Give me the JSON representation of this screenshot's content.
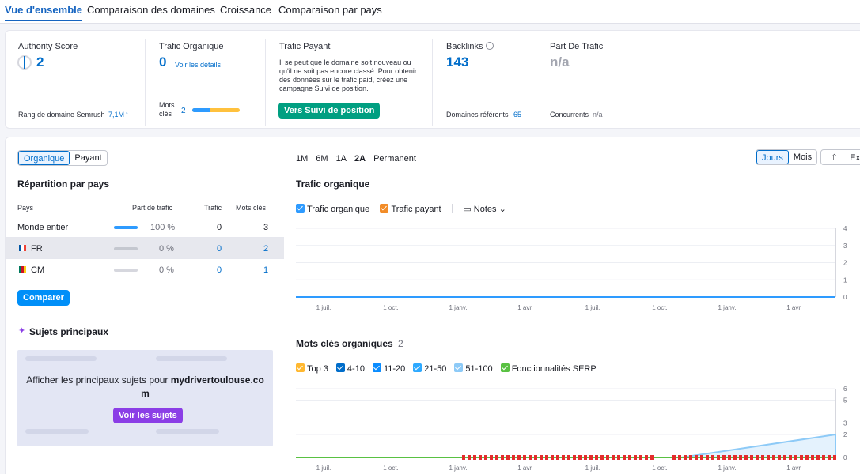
{
  "tabs": [
    "Vue d'ensemble",
    "Comparaison des domaines",
    "Croissance",
    "Comparaison par pays"
  ],
  "summary": {
    "authority": {
      "label": "Authority Score",
      "value": "2",
      "sub_label": "Rang de domaine Semrush",
      "sub_value": "7,1M",
      "sub_arrow": "↑"
    },
    "organic": {
      "label": "Trafic Organique",
      "value": "0",
      "details_link": "Voir les détails",
      "keywords_label": "Mots clés",
      "keywords_value": "2"
    },
    "paid": {
      "label": "Trafic Payant",
      "message": "Il se peut que le domaine soit nouveau ou qu'il ne soit pas encore classé. Pour obtenir des données sur le trafic paid, créez une campagne Suivi de position.",
      "button": "Vers Suivi de position"
    },
    "backlinks": {
      "label": "Backlinks",
      "value": "143",
      "ref_label": "Domaines référents",
      "ref_value": "65"
    },
    "share": {
      "label": "Part De Trafic",
      "value": "n/a",
      "comp_label": "Concurrents",
      "comp_value": "n/a"
    }
  },
  "left": {
    "toggle": [
      "Organique",
      "Payant"
    ],
    "country_title": "Répartition par pays",
    "headers": [
      "Pays",
      "Part de trafic",
      "Trafic",
      "Mots clés"
    ],
    "rows": [
      {
        "country": "Monde entier",
        "share": "100 %",
        "traffic": "0",
        "keywords": "3"
      },
      {
        "country": "FR",
        "share": "0 %",
        "traffic": "0",
        "keywords": "2"
      },
      {
        "country": "CM",
        "share": "0 %",
        "traffic": "0",
        "keywords": "1"
      }
    ],
    "compare_button": "Comparer",
    "topics_title": "Sujets principaux",
    "topics_text": "Afficher les principaux sujets pour",
    "topics_domain": "mydrivertoulouse.com",
    "topics_button": "Voir les sujets"
  },
  "right": {
    "periods": [
      "1M",
      "6M",
      "1A",
      "2A",
      "Permanent"
    ],
    "active_period": "2A",
    "view_toggle": [
      "Jours",
      "Mois"
    ],
    "export_label": "Expor",
    "traffic_title": "Trafic organique",
    "traffic_legend": [
      "Trafic organique",
      "Trafic payant"
    ],
    "notes_label": "Notes",
    "keywords_title": "Mots clés organiques",
    "keywords_count": "2",
    "keywords_legend": [
      "Top 3",
      "4-10",
      "11-20",
      "21-50",
      "51-100",
      "Fonctionnalités SERP"
    ]
  },
  "chart_data": [
    {
      "type": "line",
      "title": "Trafic organique",
      "x_ticks": [
        "1 juil.",
        "1 oct.",
        "1 janv.",
        "1 avr.",
        "1 juil.",
        "1 oct.",
        "1 janv.",
        "1 avr."
      ],
      "y_ticks": [
        "0",
        "1",
        "2",
        "3",
        "4"
      ],
      "series": [
        {
          "name": "Trafic organique",
          "values": [
            0,
            0,
            0,
            0,
            0,
            0,
            0,
            0
          ]
        }
      ],
      "ylim": [
        0,
        4
      ]
    },
    {
      "type": "area",
      "title": "Mots clés organiques",
      "x_ticks": [
        "1 juil.",
        "1 oct.",
        "1 janv.",
        "1 avr.",
        "1 juil.",
        "1 oct.",
        "1 janv.",
        "1 avr."
      ],
      "y_ticks": [
        "0",
        "2",
        "3",
        "5",
        "6"
      ],
      "series": [
        {
          "name": "51-100",
          "values": [
            0,
            0,
            0,
            0,
            0,
            0,
            1,
            2
          ]
        }
      ],
      "ylim": [
        0,
        6
      ]
    }
  ],
  "colors": {
    "accent": "#006dca",
    "green": "#009f81",
    "purple": "#8b3ee6",
    "legend_top3": "#ffb830",
    "legend_4_10": "#006dca",
    "legend_11_20": "#0a8cff",
    "legend_21_50": "#2ea9ff",
    "legend_51_100": "#8dcaf7",
    "legend_serp": "#59c142"
  }
}
